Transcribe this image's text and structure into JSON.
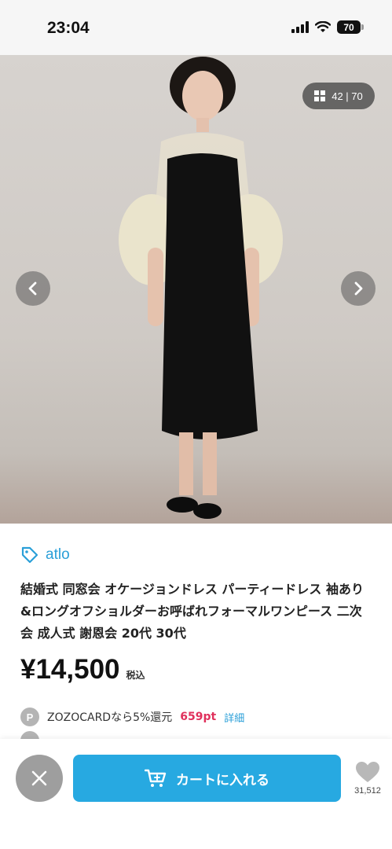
{
  "status_bar": {
    "time": "23:04",
    "battery": "70",
    "icons": [
      "signal-icon",
      "wifi-icon",
      "battery-icon"
    ]
  },
  "gallery": {
    "counter": "42 | 70",
    "icons": [
      "grid-icon",
      "chevron-left-icon",
      "chevron-right-icon"
    ]
  },
  "product": {
    "brand": "atlo",
    "title": "結婚式 同窓会 オケージョンドレス パーティードレス 袖あり&ロングオフショルダーお呼ばれフォーマルワンピース 二次会 成人式 謝恩会 20代 30代",
    "price": "¥14,500",
    "tax_label": "税込"
  },
  "promo": {
    "badge": "P",
    "text": "ZOZOCARDなら5%還元",
    "points": "659pt",
    "link": "詳細"
  },
  "bottom_bar": {
    "cart_label": "カートに入れる",
    "favorites_count": "31,512"
  },
  "colors": {
    "accent": "#27a9e1",
    "brand_link": "#2a9fd8",
    "points": "#e0315c"
  }
}
